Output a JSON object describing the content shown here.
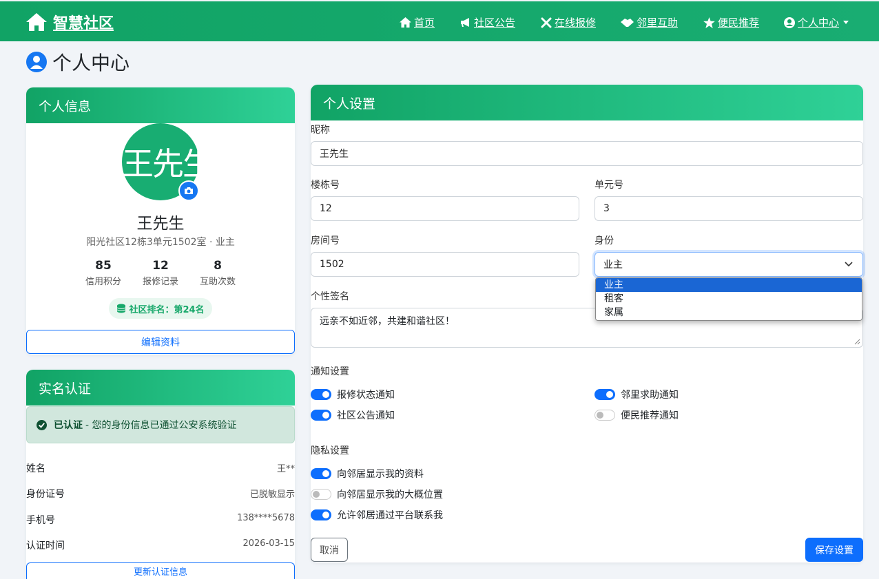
{
  "nav": {
    "brand": "智慧社区",
    "items": [
      {
        "label": "首页",
        "icon": "home-icon"
      },
      {
        "label": "社区公告",
        "icon": "megaphone-icon"
      },
      {
        "label": "在线报修",
        "icon": "tools-icon"
      },
      {
        "label": "邻里互助",
        "icon": "handshake-icon"
      },
      {
        "label": "便民推荐",
        "icon": "star-icon"
      },
      {
        "label": "个人中心",
        "icon": "user-circle-icon"
      }
    ]
  },
  "page": {
    "title": "个人中心"
  },
  "profile": {
    "header": "个人信息",
    "avatar_text": "王先生",
    "name": "王先生",
    "address": "阳光社区12栋3单元1502室 · 业主",
    "stats": [
      {
        "value": "85",
        "label": "信用积分"
      },
      {
        "value": "12",
        "label": "报修记录"
      },
      {
        "value": "8",
        "label": "互助次数"
      }
    ],
    "rank": "社区排名：第24名",
    "edit_button": "编辑资料"
  },
  "verification": {
    "header": "实名认证",
    "status_strong": "已认证",
    "status_text": "- 您的身份信息已通过公安系统验证",
    "rows": [
      {
        "label": "姓名",
        "value": "王**"
      },
      {
        "label": "身份证号",
        "value": "已脱敏显示"
      },
      {
        "label": "手机号",
        "value": "138****5678"
      },
      {
        "label": "认证时间",
        "value": "2026-03-15"
      }
    ],
    "update_button": "更新认证信息"
  },
  "settings": {
    "header": "个人设置",
    "nickname_label": "昵称",
    "nickname_value": "王先生",
    "building_label": "楼栋号",
    "building_value": "12",
    "unit_label": "单元号",
    "unit_value": "3",
    "room_label": "房间号",
    "room_value": "1502",
    "identity_label": "身份",
    "identity_value": "业主",
    "identity_options": [
      "业主",
      "租客",
      "家属"
    ],
    "signature_label": "个性签名",
    "signature_value": "远亲不如近邻，共建和谐社区！",
    "notify_title": "通知设置",
    "notify": [
      {
        "label": "报修状态通知",
        "on": true
      },
      {
        "label": "邻里求助通知",
        "on": true
      },
      {
        "label": "社区公告通知",
        "on": true
      },
      {
        "label": "便民推荐通知",
        "on": false
      }
    ],
    "privacy_title": "隐私设置",
    "privacy": [
      {
        "label": "向邻居显示我的资料",
        "on": true
      },
      {
        "label": "向邻居显示我的大概位置",
        "on": false
      },
      {
        "label": "允许邻居通过平台联系我",
        "on": true
      }
    ],
    "cancel_button": "取消",
    "save_button": "保存设置"
  },
  "colors": {
    "brand_green": "#11a365",
    "primary_blue": "#0d6efd"
  }
}
